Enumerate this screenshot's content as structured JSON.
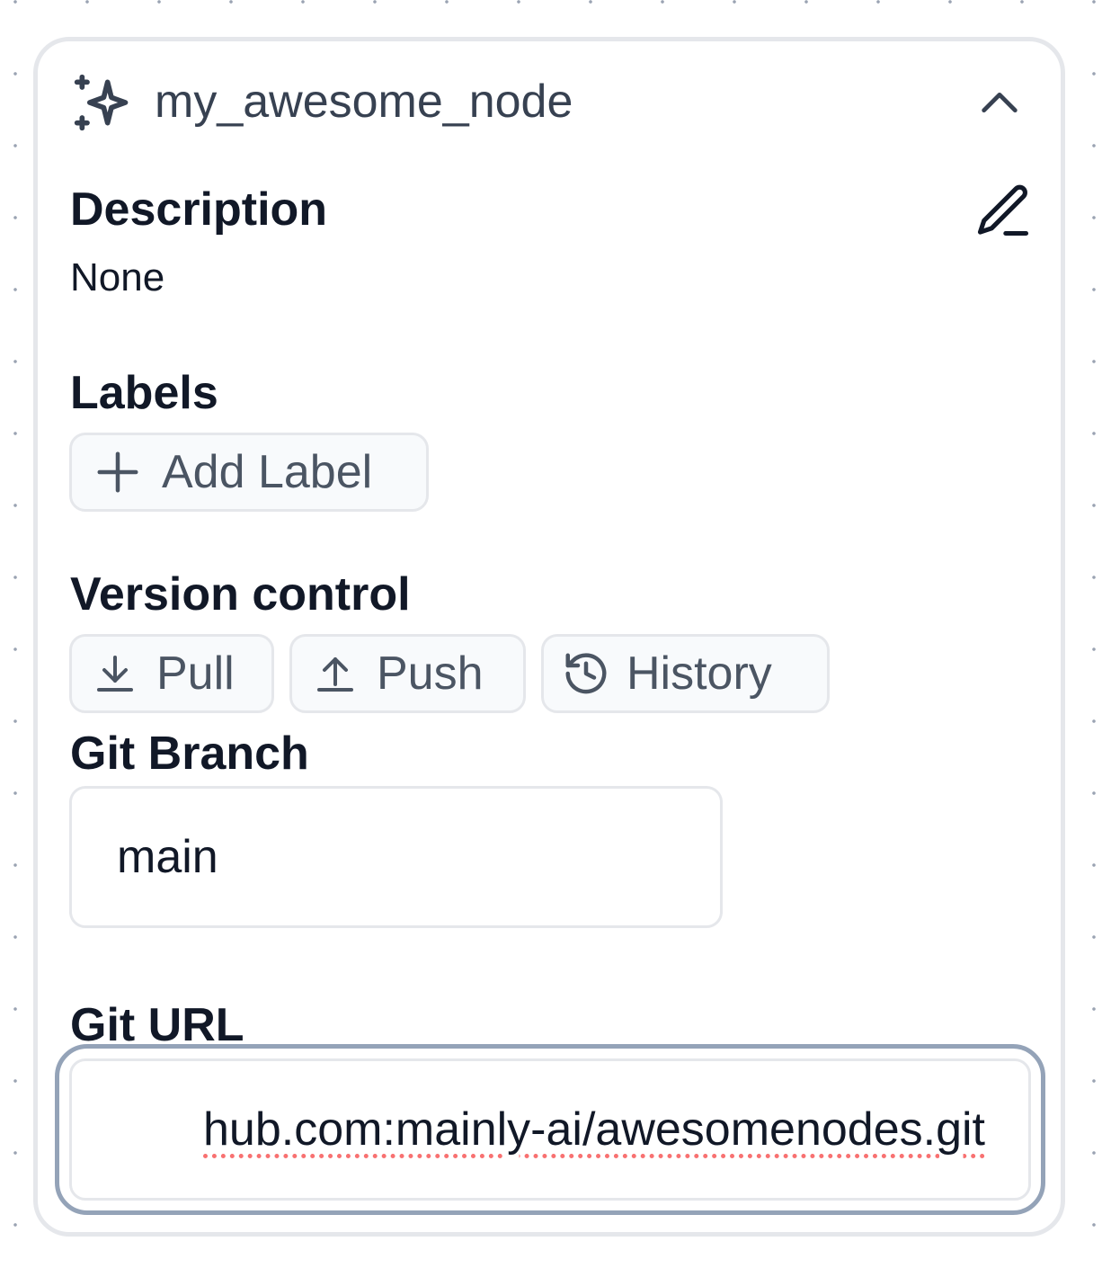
{
  "node": {
    "title": "my_awesome_node",
    "icon": "sparkles-icon",
    "collapse_icon": "chevron-up-icon"
  },
  "description": {
    "label": "Description",
    "value": "None",
    "edit_icon": "pencil-icon"
  },
  "labels": {
    "label": "Labels",
    "add_button": "Add Label",
    "add_icon": "plus-icon"
  },
  "version_control": {
    "label": "Version control",
    "pull_label": "Pull",
    "push_label": "Push",
    "history_label": "History",
    "pull_icon": "arrow-down-to-line-icon",
    "push_icon": "arrow-up-from-line-icon",
    "history_icon": "history-icon"
  },
  "git_branch": {
    "label": "Git Branch",
    "value": "main"
  },
  "git_url": {
    "label": "Git URL",
    "value": "hub.com:mainly-ai/awesomenodes.git"
  },
  "colors": {
    "card_border": "#e5e7eb",
    "focus_ring": "#94a3b8",
    "spellcheck": "#f87171",
    "title_text": "#374151"
  }
}
